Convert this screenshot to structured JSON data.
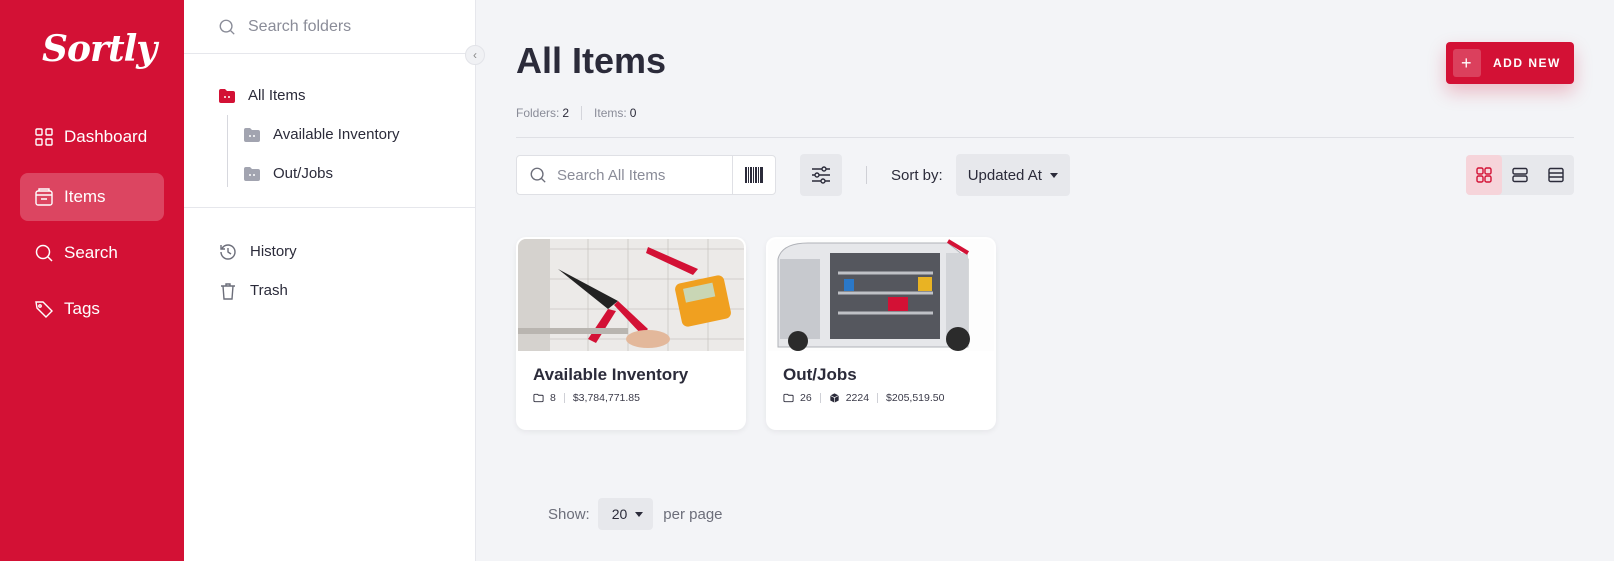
{
  "app": {
    "logo_text": "Sortly",
    "brand_color": "#d31135"
  },
  "nav": {
    "items": [
      {
        "label": "Dashboard",
        "icon": "dashboard-icon"
      },
      {
        "label": "Items",
        "icon": "items-icon",
        "active": true
      },
      {
        "label": "Search",
        "icon": "search-icon"
      },
      {
        "label": "Tags",
        "icon": "tag-icon"
      }
    ]
  },
  "folders": {
    "search_placeholder": "Search folders",
    "root": "All Items",
    "children": [
      "Available Inventory",
      "Out/Jobs"
    ],
    "history": "History",
    "trash": "Trash"
  },
  "main": {
    "title": "All Items",
    "folders_label": "Folders:",
    "folders_count": "2",
    "items_label": "Items:",
    "items_count": "0",
    "add_new": "ADD NEW",
    "search_placeholder": "Search All Items",
    "sort_label": "Sort by:",
    "sort_value": "Updated At",
    "cards": [
      {
        "name": "Available Inventory",
        "folders": "8",
        "value": "$3,784,771.85"
      },
      {
        "name": "Out/Jobs",
        "folders": "26",
        "quantity": "2224",
        "value": "$205,519.50"
      }
    ],
    "pager": {
      "show_label": "Show:",
      "per_page_value": "20",
      "per_page_label": "per page"
    }
  }
}
